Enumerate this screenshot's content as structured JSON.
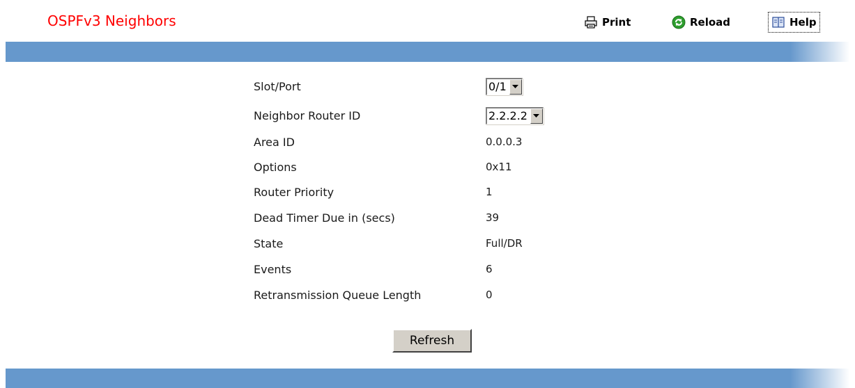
{
  "header": {
    "title": "OSPFv3 Neighbors",
    "print_label": "Print",
    "reload_label": "Reload",
    "help_label": "Help"
  },
  "form": {
    "slot_port": {
      "label": "Slot/Port",
      "value": "0/1"
    },
    "neighbor_router_id": {
      "label": "Neighbor Router ID",
      "value": "2.2.2.2"
    },
    "area_id": {
      "label": "Area ID",
      "value": "0.0.0.3"
    },
    "options": {
      "label": "Options",
      "value": "0x11"
    },
    "router_priority": {
      "label": "Router Priority",
      "value": "1"
    },
    "dead_timer": {
      "label": "Dead Timer Due in (secs)",
      "value": "39"
    },
    "state": {
      "label": "State",
      "value": "Full/DR"
    },
    "events": {
      "label": "Events",
      "value": "6"
    },
    "retransmission_queue_length": {
      "label": "Retransmission Queue Length",
      "value": "0"
    }
  },
  "actions": {
    "refresh_label": "Refresh"
  },
  "colors": {
    "title": "#ff0000",
    "bar": "#6698cc",
    "button_face": "#d4d0c8"
  },
  "icons": {
    "print": "printer-icon",
    "reload": "reload-icon",
    "help": "book-icon",
    "dropdown": "chevron-down-icon"
  }
}
